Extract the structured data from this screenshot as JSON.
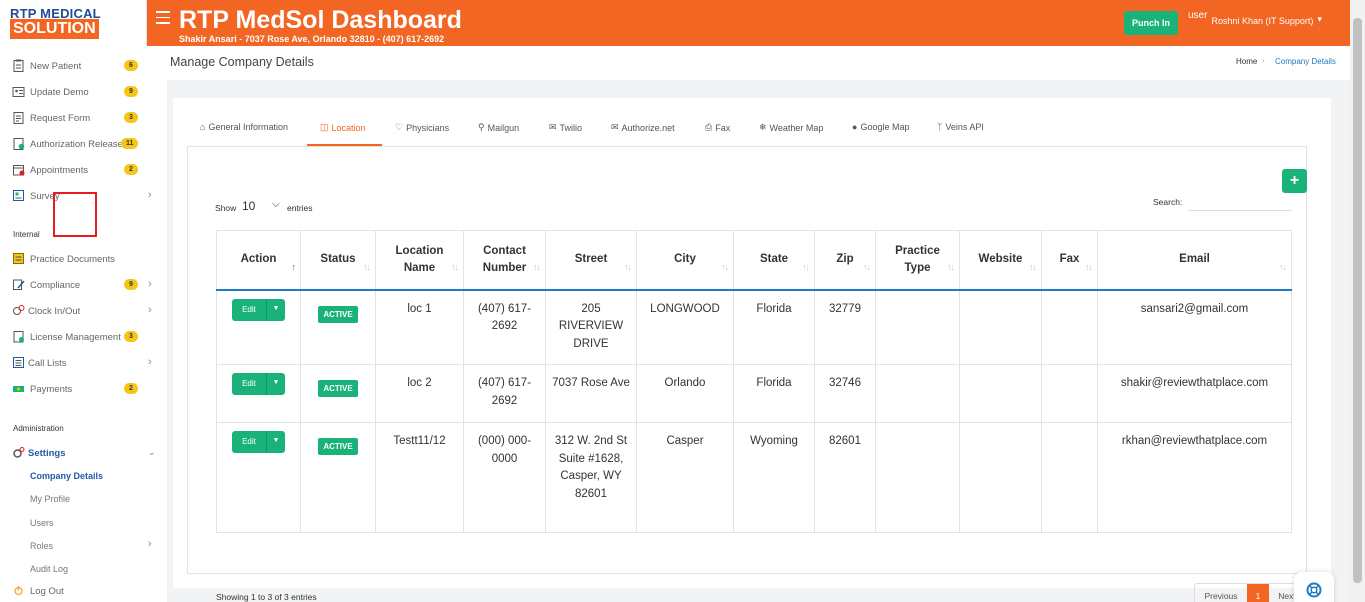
{
  "header": {
    "logo_top": "RTP MEDICAL",
    "logo_bottom": "SOLUTION",
    "title": "RTP MedSol Dashboard",
    "subtitle": "Shakir Ansari - 7037 Rose Ave, Orlando 32810 - (407) 617-2692",
    "punch_label": "Punch In",
    "user_img_alt": "user",
    "user_name": "Roshni Khan (IT Support)"
  },
  "sidebar": {
    "items": [
      {
        "label": "New Patient",
        "badge": "6",
        "icon": "clipboard-icon"
      },
      {
        "label": "Update Demo",
        "badge": "9",
        "icon": "id-card-icon"
      },
      {
        "label": "Request Form",
        "badge": "3",
        "icon": "clipboard-icon"
      },
      {
        "label": "Authorization Release",
        "badge": "11",
        "icon": "clipboard-check-icon"
      },
      {
        "label": "Appointments",
        "badge": "2",
        "icon": "calendar-icon"
      },
      {
        "label": "Survey",
        "icon": "survey-icon"
      }
    ],
    "internal_heading": "Internal",
    "internal_items": [
      {
        "label": "Practice Documents",
        "icon": "document-icon"
      },
      {
        "label": "Compliance",
        "badge": "9",
        "icon": "pen-icon"
      },
      {
        "label": "Clock In/Out",
        "icon": "clock-icon"
      },
      {
        "label": "License Management",
        "badge": "3",
        "icon": "license-icon"
      },
      {
        "label": "Call Lists",
        "icon": "list-icon"
      },
      {
        "label": "Payments",
        "badge": "2",
        "icon": "money-icon"
      }
    ],
    "admin_heading": "Administration",
    "settings_label": "Settings",
    "settings_sub": [
      "Company Details",
      "My Profile",
      "Users",
      "Roles",
      "Audit Log"
    ],
    "logout_label": "Log Out"
  },
  "page": {
    "title": "Manage Company Details",
    "breadcrumb_home": "Home",
    "breadcrumb_current": "Company Details"
  },
  "tabs": [
    {
      "label": "General Information",
      "icon": "home-icon"
    },
    {
      "label": "Location",
      "icon": "map-icon"
    },
    {
      "label": "Physicians",
      "icon": "heart-icon"
    },
    {
      "label": "Mailgun",
      "icon": "user-icon"
    },
    {
      "label": "Twilio",
      "icon": "envelope-icon"
    },
    {
      "label": "Authorize.net",
      "icon": "envelope-icon"
    },
    {
      "label": "Fax",
      "icon": "fax-icon"
    },
    {
      "label": "Weather Map",
      "icon": "snowflake-icon"
    },
    {
      "label": "Google Map",
      "icon": "pin-icon"
    },
    {
      "label": "Veins API",
      "icon": "branch-icon"
    }
  ],
  "controls": {
    "add_label": "+",
    "show_label": "Show",
    "entries_value": "10",
    "entries_label": "entries",
    "search_label": "Search:",
    "search_value": ""
  },
  "table": {
    "headers": [
      "Action",
      "Status",
      "Location Name",
      "Contact Number",
      "Street",
      "City",
      "State",
      "Zip",
      "Practice Type",
      "Website",
      "Fax",
      "Email"
    ],
    "edit_label": "Edit",
    "rows": [
      {
        "status": "ACTIVE",
        "name": "loc 1",
        "contact": "(407) 617-2692",
        "street": "205 RIVERVIEW DRIVE",
        "city": "LONGWOOD",
        "state": "Florida",
        "zip": "32779",
        "practice_type": "",
        "website": "",
        "fax": "",
        "email": "sansari2@gmail.com"
      },
      {
        "status": "ACTIVE",
        "name": "loc 2",
        "contact": "(407) 617-2692",
        "street": "7037 Rose Ave",
        "city": "Orlando",
        "state": "Florida",
        "zip": "32746",
        "practice_type": "",
        "website": "",
        "fax": "",
        "email": "shakir@reviewthatplace.com"
      },
      {
        "status": "ACTIVE",
        "name": "Testt11/12",
        "contact": "(000) 000-0000",
        "street": "312 W. 2nd St Suite #1628, Casper, WY 82601",
        "city": "Casper",
        "state": "Wyoming",
        "zip": "82601",
        "practice_type": "",
        "website": "",
        "fax": "",
        "email": "rkhan@reviewthatplace.com"
      }
    ]
  },
  "footer": {
    "showing": "Showing 1 to 3 of 3 entries",
    "prev": "Previous",
    "page": "1",
    "next": "Next"
  },
  "colors": {
    "brand": "#f26522",
    "success": "#19b37a",
    "link": "#1f7ac2",
    "highlight": "#e51c23"
  }
}
